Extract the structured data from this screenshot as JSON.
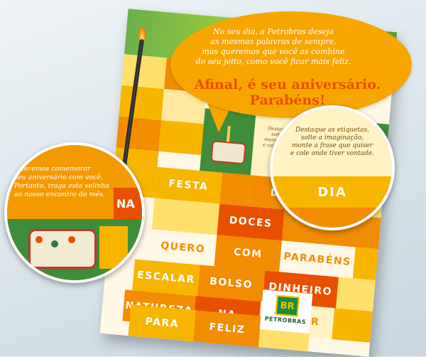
{
  "bubble": {
    "message_lines": [
      "No seu dia, a Petrobras deseja",
      "as mesmas palavras de sempre,",
      "mas queremos que você as combine",
      "do seu jeito, como você ficar mais feliz."
    ],
    "headline_1": "Afinal, é seu aniversário.",
    "headline_2": "Parabéns!"
  },
  "card": {
    "instruction_lines": [
      "Destaque as etiquetas,",
      "solte a imaginação,",
      "monte a frase que quiser",
      "e cole onde tiver vontade."
    ],
    "words": {
      "dia": "DIA",
      "festa": "FESTA",
      "doces": "DOCES",
      "quero": "QUERO",
      "com": "COM",
      "parabens": "PARABÉNS",
      "escalar": "ESCALAR",
      "bolso": "BOLSO",
      "dinheiro": "DINHEIRO",
      "natureza": "NATUREZA",
      "na": "NA",
      "sentir": "SENTIR",
      "para": "PARA",
      "feliz": "FELIZ"
    }
  },
  "left_zoom": {
    "invite_lines": [
      "Queremos comemorar",
      "seu aniversário com você.",
      "Portanto, traga esta velinha",
      "ao nosso encontro do mês."
    ],
    "partial_word": "NA"
  },
  "right_zoom": {
    "instruction_lines": [
      "Destaque as etiquetas,",
      "solte a imaginação,",
      "monte a frase que quiser",
      "e cole onde tiver vontade."
    ],
    "word": "DIA"
  },
  "logo": {
    "mark": "BR",
    "name": "PETROBRAS"
  },
  "colors": {
    "orange": "#f28c00",
    "yellow": "#f7b500",
    "light_yellow": "#ffe06a",
    "deep_orange": "#e85000",
    "petrobras_green": "#1f8a3a",
    "petrobras_yellow": "#f2c200"
  }
}
